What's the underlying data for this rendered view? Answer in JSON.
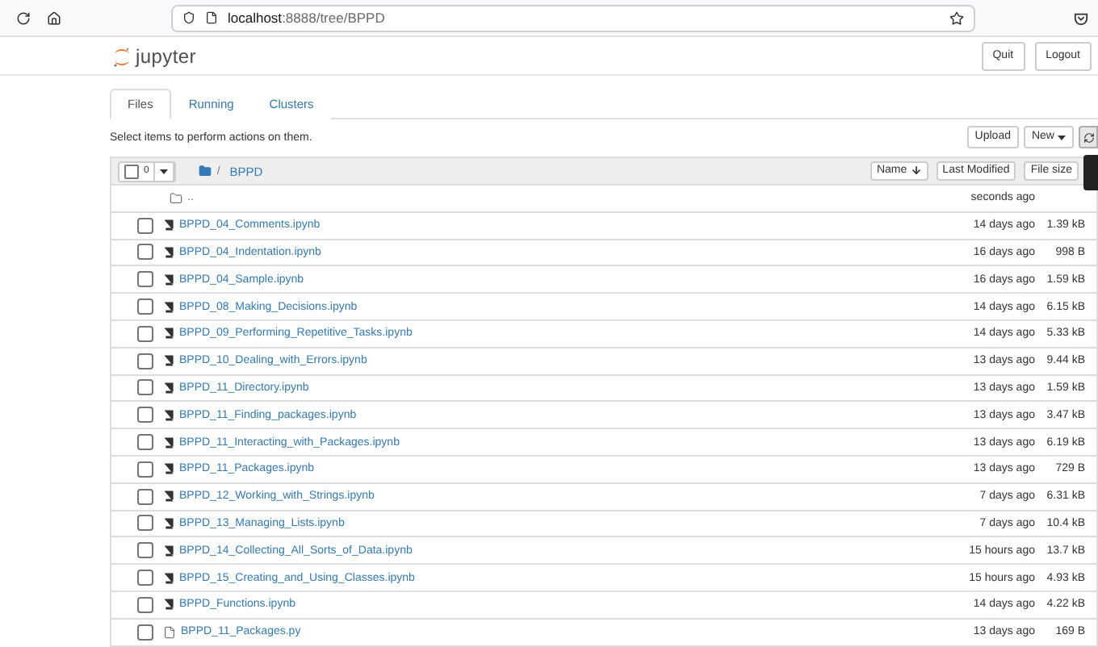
{
  "browser": {
    "address": {
      "host": "localhost",
      "path": ":8888/tree/BPPD"
    }
  },
  "header": {
    "logo_text": "jupyter",
    "buttons": [
      "Quit",
      "Logout"
    ]
  },
  "tabs": [
    {
      "label": "Files",
      "selected": true
    },
    {
      "label": "Running",
      "selected": false
    },
    {
      "label": "Clusters",
      "selected": false
    }
  ],
  "toolbar": {
    "hint": "Select items to perform actions on them.",
    "actions": [
      {
        "kind": "button",
        "label": "Upload"
      },
      {
        "kind": "dropdown",
        "label": "New"
      }
    ]
  },
  "list_header": {
    "select_all_checked": false,
    "selected_count": "0",
    "separator": "/",
    "breadcrumb": "BPPD",
    "sort_buttons": [
      {
        "label": "Name",
        "sorted": true
      },
      {
        "label": "Last Modified",
        "sorted": false
      },
      {
        "label": "File size",
        "sorted": false
      }
    ]
  },
  "parent_row": {
    "name": "..",
    "modified": "seconds ago"
  },
  "files": [
    {
      "kind": "notebook",
      "name": "BPPD_04_Comments.ipynb",
      "modified": "14 days ago",
      "size": "1.39 kB",
      "checked": false
    },
    {
      "kind": "notebook",
      "name": "BPPD_04_Indentation.ipynb",
      "modified": "16 days ago",
      "size": "998 B",
      "checked": false
    },
    {
      "kind": "notebook",
      "name": "BPPD_04_Sample.ipynb",
      "modified": "16 days ago",
      "size": "1.59 kB",
      "checked": false
    },
    {
      "kind": "notebook",
      "name": "BPPD_08_Making_Decisions.ipynb",
      "modified": "14 days ago",
      "size": "6.15 kB",
      "checked": false
    },
    {
      "kind": "notebook",
      "name": "BPPD_09_Performing_Repetitive_Tasks.ipynb",
      "modified": "14 days ago",
      "size": "5.33 kB",
      "checked": false
    },
    {
      "kind": "notebook",
      "name": "BPPD_10_Dealing_with_Errors.ipynb",
      "modified": "13 days ago",
      "size": "9.44 kB",
      "checked": false
    },
    {
      "kind": "notebook",
      "name": "BPPD_11_Directory.ipynb",
      "modified": "13 days ago",
      "size": "1.59 kB",
      "checked": false
    },
    {
      "kind": "notebook",
      "name": "BPPD_11_Finding_packages.ipynb",
      "modified": "13 days ago",
      "size": "3.47 kB",
      "checked": false
    },
    {
      "kind": "notebook",
      "name": "BPPD_11_Interacting_with_Packages.ipynb",
      "modified": "13 days ago",
      "size": "6.19 kB",
      "checked": false
    },
    {
      "kind": "notebook",
      "name": "BPPD_11_Packages.ipynb",
      "modified": "13 days ago",
      "size": "729 B",
      "checked": false
    },
    {
      "kind": "notebook",
      "name": "BPPD_12_Working_with_Strings.ipynb",
      "modified": "7 days ago",
      "size": "6.31 kB",
      "checked": false
    },
    {
      "kind": "notebook",
      "name": "BPPD_13_Managing_Lists.ipynb",
      "modified": "7 days ago",
      "size": "10.4 kB",
      "checked": false
    },
    {
      "kind": "notebook",
      "name": "BPPD_14_Collecting_All_Sorts_of_Data.ipynb",
      "modified": "15 hours ago",
      "size": "13.7 kB",
      "checked": false
    },
    {
      "kind": "notebook",
      "name": "BPPD_15_Creating_and_Using_Classes.ipynb",
      "modified": "15 hours ago",
      "size": "4.93 kB",
      "checked": false
    },
    {
      "kind": "notebook",
      "name": "BPPD_Functions.ipynb",
      "modified": "14 days ago",
      "size": "4.22 kB",
      "checked": false
    },
    {
      "kind": "file",
      "name": "BPPD_11_Packages.py",
      "modified": "13 days ago",
      "size": "169 B",
      "checked": false
    }
  ]
}
